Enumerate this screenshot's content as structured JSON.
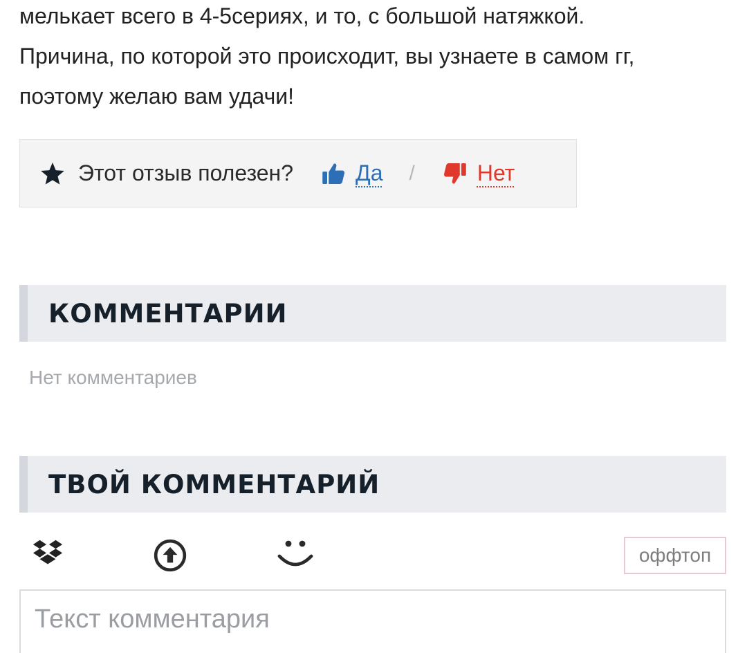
{
  "review": {
    "lines": [
      "мелькает всего в 4-5сериях, и то, с большой натяжкой.",
      "Причина, по которой это происходит, вы узнаете в самом гг,",
      "поэтому желаю вам удачи!"
    ]
  },
  "helpful": {
    "question": "Этот отзыв полезен?",
    "yes_label": "Да",
    "separator": "/",
    "no_label": "Нет",
    "star_icon": "star-icon",
    "yes_icon": "thumbs-up-icon",
    "no_icon": "thumbs-down-icon",
    "colors": {
      "yes": "#2c6fb6",
      "no": "#e0392b"
    }
  },
  "comments": {
    "title": "КОММЕНТАРИИ",
    "empty_text": "Нет комментариев"
  },
  "your_comment": {
    "title": "ТВОЙ КОММЕНТАРИЙ",
    "toolbar": {
      "icons": [
        "dropbox-icon",
        "upload-icon",
        "smile-icon"
      ],
      "offtop_label": "оффтоп"
    },
    "placeholder": "Текст комментария"
  }
}
